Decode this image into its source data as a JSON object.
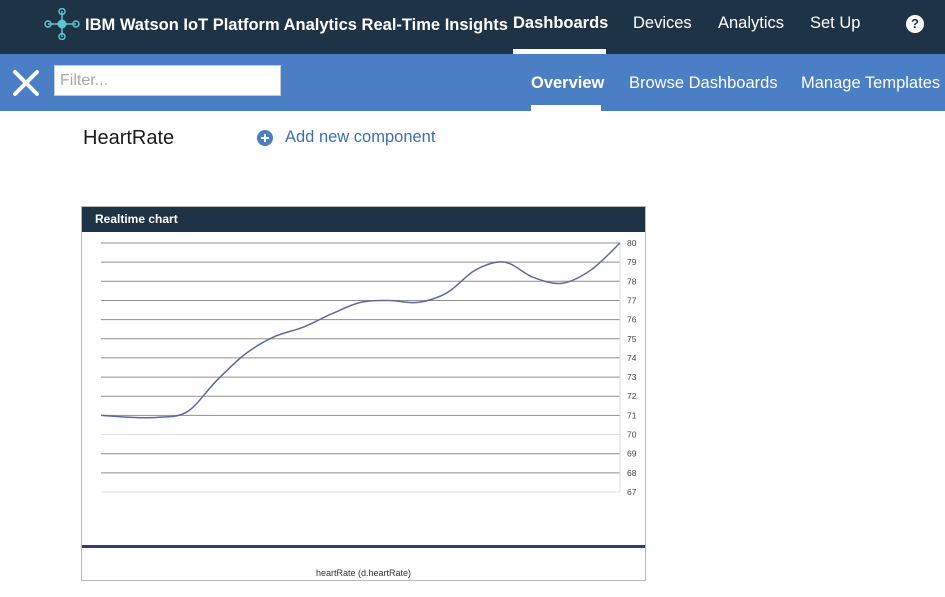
{
  "header": {
    "app_title": "IBM Watson IoT Platform Analytics Real-Time Insights",
    "nav": [
      {
        "label": "Dashboards",
        "active": true
      },
      {
        "label": "Devices",
        "active": false
      },
      {
        "label": "Analytics",
        "active": false
      },
      {
        "label": "Set Up",
        "active": false
      }
    ],
    "help_icon": "question-mark-icon",
    "help_glyph": "?"
  },
  "subbar": {
    "close_icon": "close-icon",
    "filter": {
      "placeholder": "Filter...",
      "value": ""
    },
    "tabs": [
      {
        "label": "Overview",
        "active": true
      },
      {
        "label": "Browse Dashboards",
        "active": false
      },
      {
        "label": "Manage Templates",
        "active": false
      }
    ]
  },
  "page": {
    "title": "HeartRate",
    "add_component_label": "Add new component",
    "add_icon": "plus-circle-icon"
  },
  "colors": {
    "top_bar": "#1f3347",
    "sub_bar": "#4a7fc6",
    "accent_link": "#3d70b2",
    "series_line": "#5c6a9c"
  },
  "card": {
    "title": "Realtime chart"
  },
  "chart_data": {
    "type": "line",
    "title": "Realtime chart",
    "xlabel": "heartRate (d.heartRate)",
    "ylabel": "",
    "ylim": [
      67,
      80
    ],
    "y_ticks": [
      80,
      79,
      78,
      77,
      76,
      75,
      74,
      73,
      72,
      71,
      70,
      69,
      68,
      67
    ],
    "y_axis_position": "right",
    "grid": true,
    "series": [
      {
        "values": [
          71,
          70.9,
          70.9,
          71.2,
          72.8,
          74.2,
          75.1,
          75.6,
          76.3,
          76.9,
          77.0,
          76.9,
          77.4,
          78.6,
          79.0,
          78.2,
          77.9,
          78.6,
          80.0
        ]
      }
    ]
  }
}
